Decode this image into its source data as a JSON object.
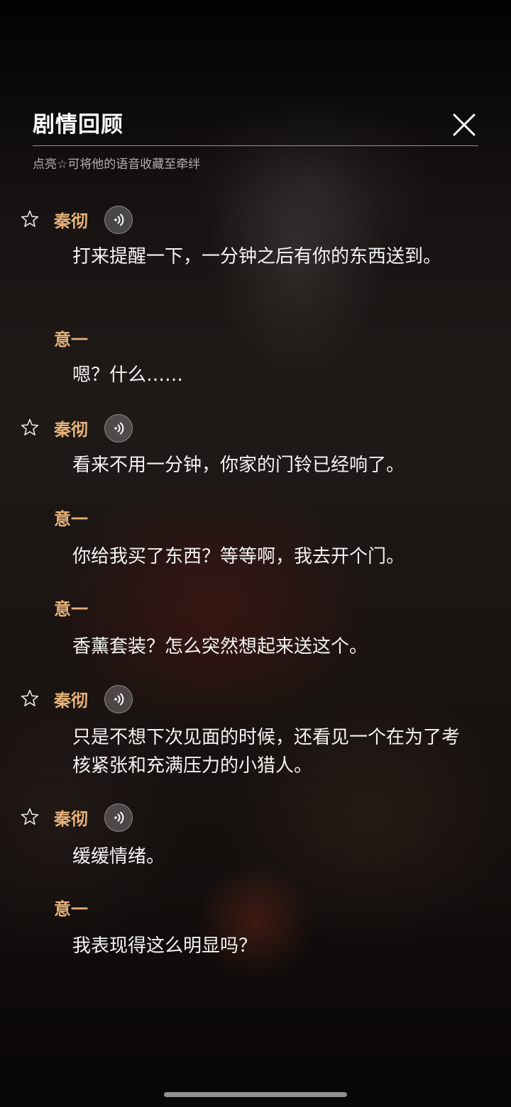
{
  "header": {
    "title": "剧情回顾",
    "hint": "点亮☆可将他的语音收藏至牵绊"
  },
  "icons": {
    "close": "close-icon",
    "star": "star-outline-icon",
    "voice": "voice-play-icon"
  },
  "colors": {
    "speaker_name": "#e7b27a",
    "text": "#f4f4f4"
  },
  "dialogue": [
    {
      "speaker": "秦彻",
      "text": "打来提醒一下，一分钟之后有你的东西送到。",
      "has_voice": true
    },
    {
      "speaker": "意一",
      "text": "嗯？什么……",
      "has_voice": false
    },
    {
      "speaker": "秦彻",
      "text": "看来不用一分钟，你家的门铃已经响了。",
      "has_voice": true
    },
    {
      "speaker": "意一",
      "text": "你给我买了东西？等等啊，我去开个门。",
      "has_voice": false
    },
    {
      "speaker": "意一",
      "text": "香薰套装？怎么突然想起来送这个。",
      "has_voice": false
    },
    {
      "speaker": "秦彻",
      "text": "只是不想下次见面的时候，还看见一个在为了考核紧张和充满压力的小猎人。",
      "has_voice": true
    },
    {
      "speaker": "秦彻",
      "text": "缓缓情绪。",
      "has_voice": true
    },
    {
      "speaker": "意一",
      "text": "我表现得这么明显吗？",
      "has_voice": false
    }
  ]
}
